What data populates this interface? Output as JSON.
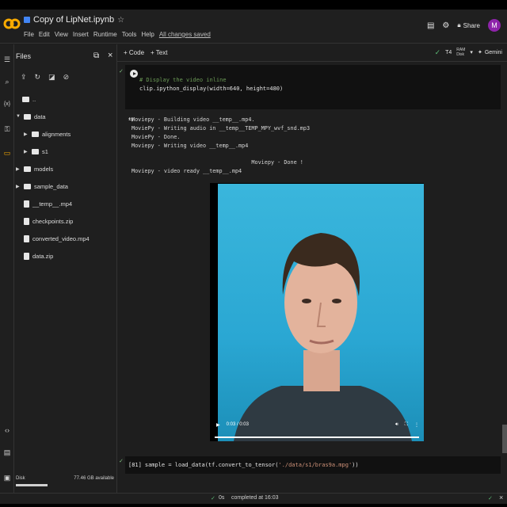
{
  "window": {
    "notebook_title": "Copy of LipNet.ipynb"
  },
  "menu": [
    "File",
    "Edit",
    "View",
    "Insert",
    "Runtime",
    "Tools",
    "Help"
  ],
  "save_status": "All changes saved",
  "header_right": {
    "share": "Share",
    "avatar_letter": "M"
  },
  "files_panel": {
    "title": "Files",
    "tree": [
      {
        "label": "..",
        "type": "folder-up"
      },
      {
        "label": "data",
        "type": "folder",
        "expanded": true
      },
      {
        "label": "alignments",
        "type": "folder"
      },
      {
        "label": "s1",
        "type": "folder"
      },
      {
        "label": "models",
        "type": "folder"
      },
      {
        "label": "sample_data",
        "type": "folder"
      },
      {
        "label": "__temp__.mp4",
        "type": "file"
      },
      {
        "label": "checkpoints.zip",
        "type": "file"
      },
      {
        "label": "converted_video.mp4",
        "type": "file"
      },
      {
        "label": "data.zip",
        "type": "file"
      }
    ],
    "disk": {
      "label": "Disk",
      "available": "77.46 GB available",
      "used_fraction": 0.33
    }
  },
  "toolbar": {
    "code": "+ Code",
    "text": "+ Text",
    "runtime": "T4",
    "ram": "RAM",
    "disk": "Disk",
    "gemini": "Gemini"
  },
  "cells": {
    "cell1": {
      "comment": "# Display the video inline",
      "code": "clip.ipython_display(width=640, height=480)"
    },
    "output": [
      "Moviepy - Building video __temp__.mp4.",
      "MoviePy - Writing audio in __temp__TEMP_MPY_wvf_snd.mp3",
      "MoviePy - Done.",
      "Moviepy - Writing video __temp__.mp4",
      "",
      "                                     Moviepy - Done !",
      "Moviepy - video ready __temp__.mp4"
    ],
    "video": {
      "time": "0:03 / 0:03",
      "progress": 1.0
    },
    "cell2": {
      "exec_count": "[81]",
      "code_prefix": "sample = load_data(tf.convert_to_tensor(",
      "code_string": "'./data/s1/bras9a.mpg'",
      "code_suffix": "))"
    }
  },
  "statusbar": {
    "check": "✓",
    "duration": "0s",
    "completed": "completed at 16:03"
  },
  "colors": {
    "accent_orange": "#f9ab00",
    "green_check": "#5bb974",
    "avatar": "#8e24aa"
  }
}
